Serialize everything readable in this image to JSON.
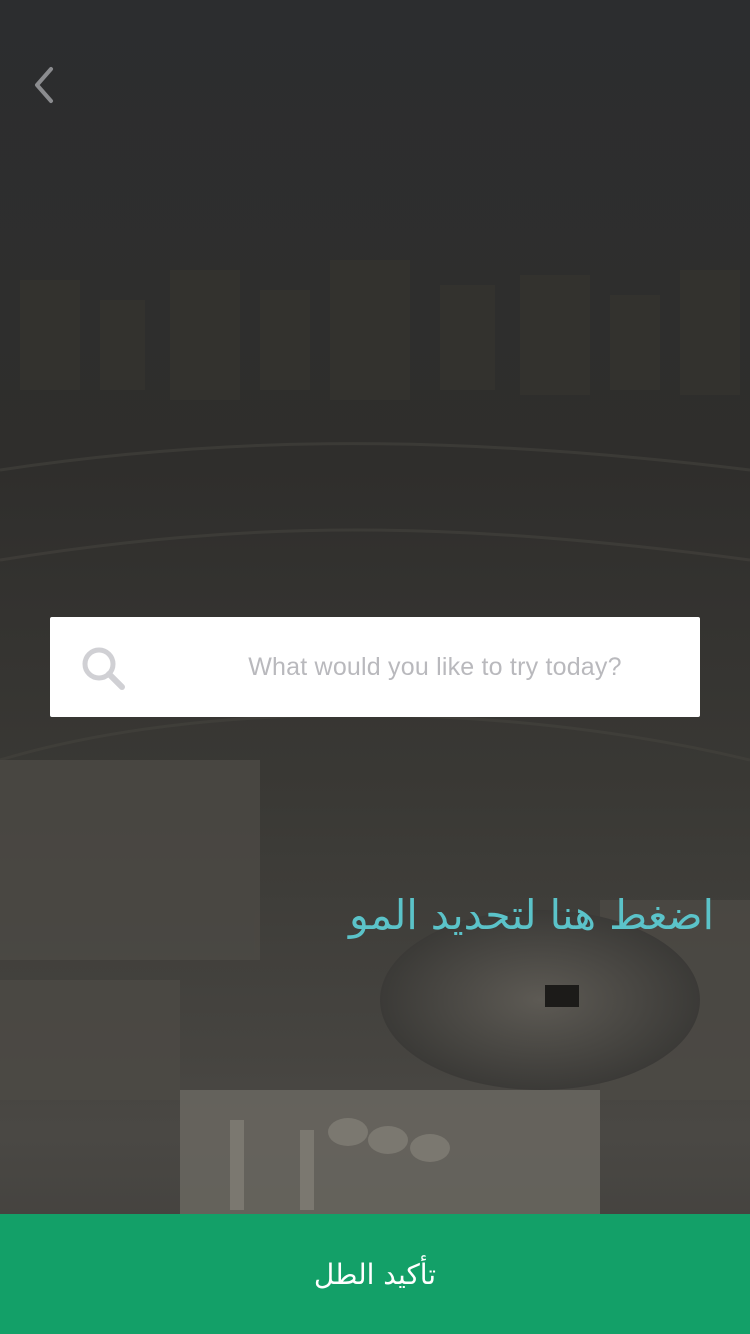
{
  "header": {
    "back_icon": "chevron-left-icon"
  },
  "search": {
    "icon": "search-icon",
    "placeholder": "What would you like to try today?",
    "value": ""
  },
  "location": {
    "label": "اضغط هنا لتحديد المو"
  },
  "footer": {
    "confirm_label": "تأكيد الطل"
  },
  "colors": {
    "accent_teal": "#5bc3c9",
    "confirm_green": "#13a068",
    "overlay": "#2a2b2d"
  }
}
